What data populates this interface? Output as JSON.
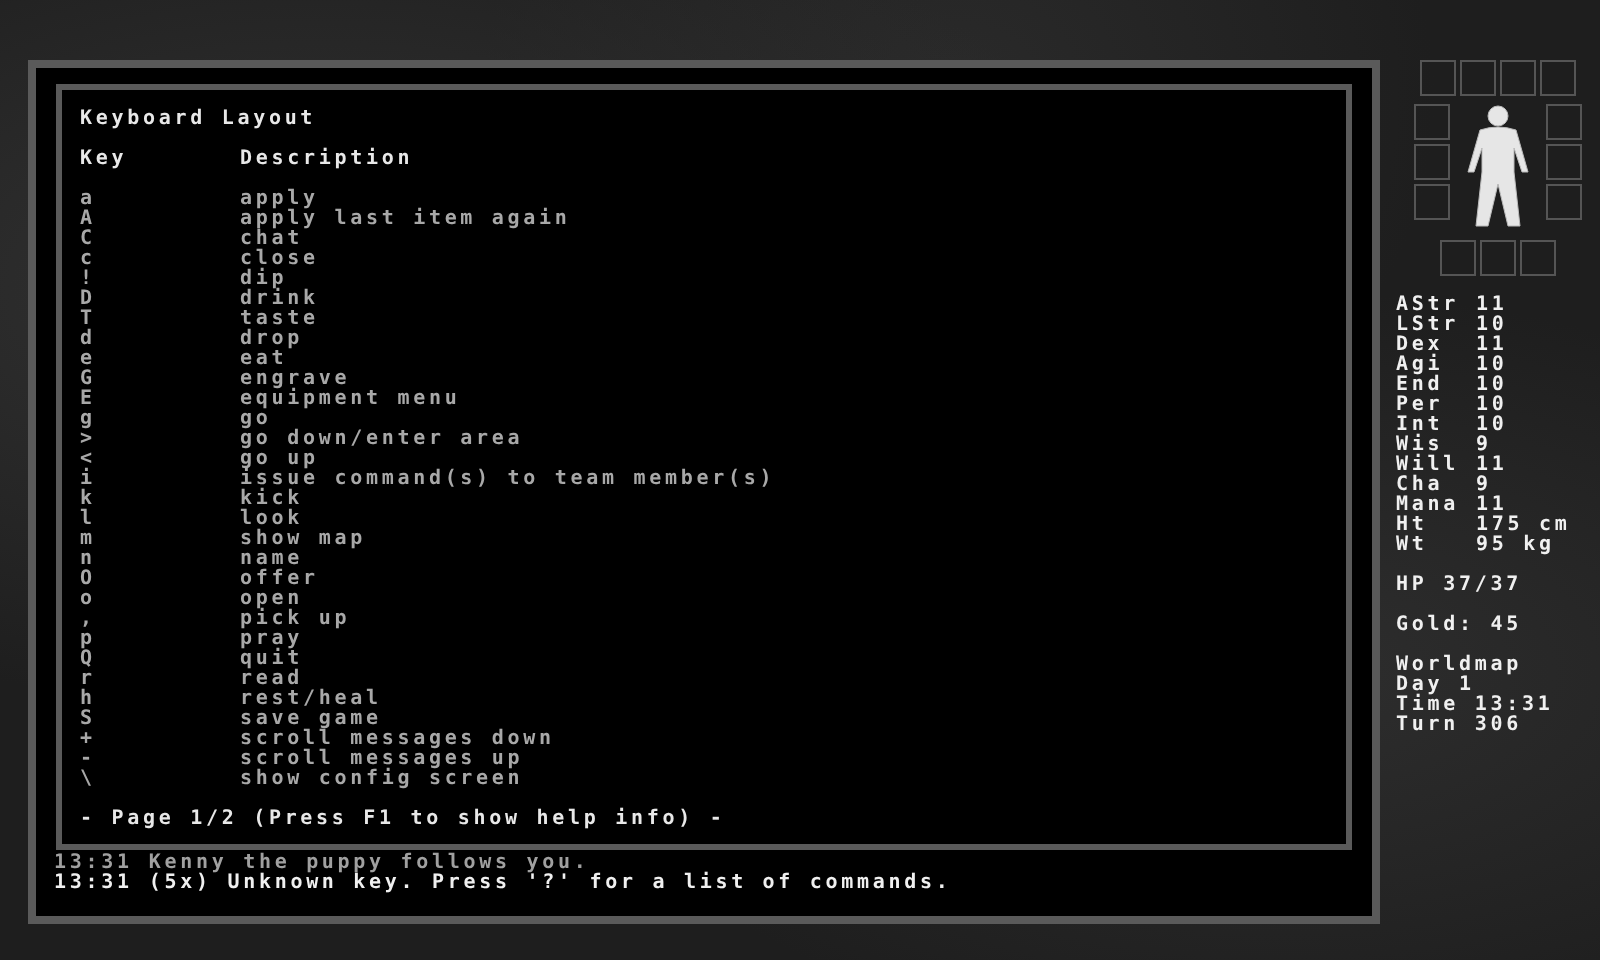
{
  "help": {
    "title": "Keyboard Layout",
    "columns": [
      "Key",
      "Description"
    ],
    "rows": [
      {
        "key": "a",
        "description": "apply"
      },
      {
        "key": "A",
        "description": "apply last item again"
      },
      {
        "key": "C",
        "description": "chat"
      },
      {
        "key": "c",
        "description": "close"
      },
      {
        "key": "!",
        "description": "dip"
      },
      {
        "key": "D",
        "description": "drink"
      },
      {
        "key": "T",
        "description": "taste"
      },
      {
        "key": "d",
        "description": "drop"
      },
      {
        "key": "e",
        "description": "eat"
      },
      {
        "key": "G",
        "description": "engrave"
      },
      {
        "key": "E",
        "description": "equipment menu"
      },
      {
        "key": "g",
        "description": "go"
      },
      {
        "key": ">",
        "description": "go down/enter area"
      },
      {
        "key": "<",
        "description": "go up"
      },
      {
        "key": "i",
        "description": "issue command(s) to team member(s)"
      },
      {
        "key": "k",
        "description": "kick"
      },
      {
        "key": "l",
        "description": "look"
      },
      {
        "key": "m",
        "description": "show map"
      },
      {
        "key": "n",
        "description": "name"
      },
      {
        "key": "O",
        "description": "offer"
      },
      {
        "key": "o",
        "description": "open"
      },
      {
        "key": ",",
        "description": "pick up"
      },
      {
        "key": "p",
        "description": "pray"
      },
      {
        "key": "Q",
        "description": "quit"
      },
      {
        "key": "r",
        "description": "read"
      },
      {
        "key": "h",
        "description": "rest/heal"
      },
      {
        "key": "S",
        "description": "save game"
      },
      {
        "key": "+",
        "description": "scroll messages down"
      },
      {
        "key": "-",
        "description": "scroll messages up"
      },
      {
        "key": "\\",
        "description": "show config screen"
      }
    ],
    "footer": "- Page 1/2 (Press F1 to show help info) -"
  },
  "messages": [
    {
      "time": "13:31",
      "text": "Kenny the puppy follows you.",
      "recent": false
    },
    {
      "time": "13:31",
      "text": "(5x) Unknown key. Press '?' for a list of commands.",
      "recent": true
    }
  ],
  "stats": [
    {
      "label": "AStr",
      "value": "11"
    },
    {
      "label": "LStr",
      "value": "10"
    },
    {
      "label": "Dex",
      "value": "11"
    },
    {
      "label": "Agi",
      "value": "10"
    },
    {
      "label": "End",
      "value": "10"
    },
    {
      "label": "Per",
      "value": "10"
    },
    {
      "label": "Int",
      "value": "10"
    },
    {
      "label": "Wis",
      "value": "9"
    },
    {
      "label": "Will",
      "value": "11"
    },
    {
      "label": "Cha",
      "value": "9"
    },
    {
      "label": "Mana",
      "value": "11"
    },
    {
      "label": "Ht",
      "value": "175 cm"
    },
    {
      "label": "Wt",
      "value": "95 kg"
    }
  ],
  "hp": "HP 37/37",
  "gold": "Gold: 45",
  "status": [
    "Worldmap",
    "Day 1",
    "Time 13:31",
    "Turn 306"
  ]
}
